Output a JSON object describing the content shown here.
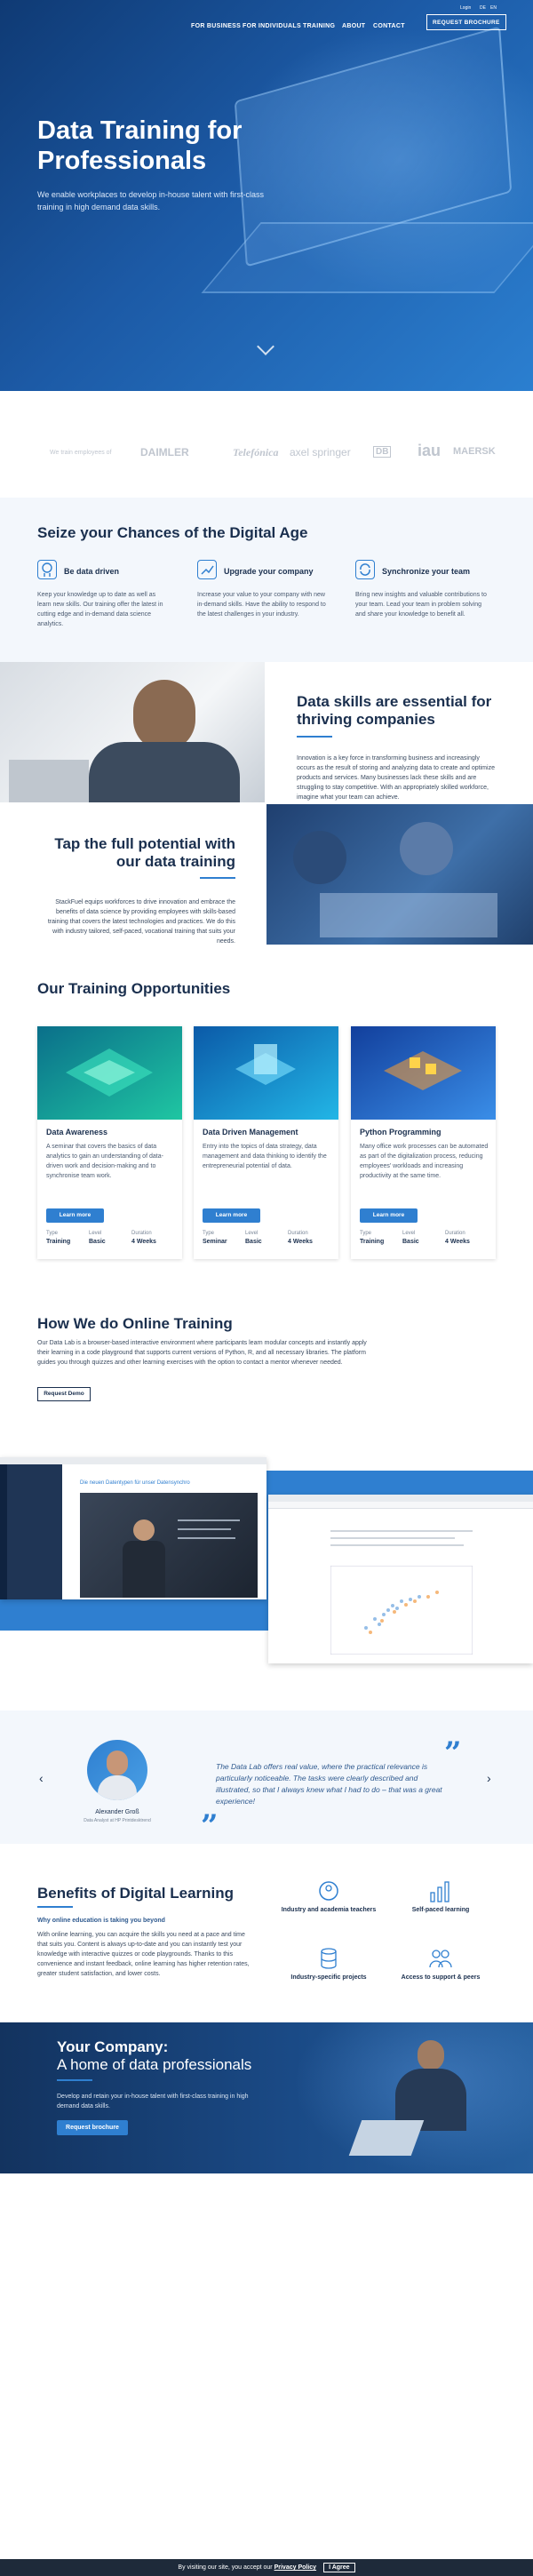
{
  "header": {
    "login": "Login",
    "lang_de": "DE",
    "lang_en": "EN",
    "nav": [
      "FOR BUSINESS",
      "FOR INDIVIDUALS",
      "TRAINING",
      "ABOUT",
      "CONTACT"
    ],
    "cta": "REQUEST BROCHURE"
  },
  "hero": {
    "title": "Data Training for Professionals",
    "subtitle": "We enable workplaces to develop in-house talent with first-class training in high demand data skills."
  },
  "logos": {
    "intro": "We train employees of",
    "items": [
      "DAIMLER",
      "Telefónica",
      "axel springer",
      "DB",
      "iau",
      "MAERSK"
    ]
  },
  "chances": {
    "title": "Seize your Chances of the Digital Age",
    "features": [
      {
        "title": "Be data driven",
        "text": "Keep your knowledge up to date as well as learn new skills. Our training offer the latest in cutting edge and in-demand data science analytics."
      },
      {
        "title": "Upgrade your company",
        "text": "Increase your value to your company with new in-demand skills. Have the ability to respond to the latest challenges in your industry."
      },
      {
        "title": "Synchronize your team",
        "text": "Bring new insights and valuable contributions to your team. Lead your team in problem solving and share your knowledge to benefit all."
      }
    ]
  },
  "skills": {
    "title": "Data skills are essential for thriving companies",
    "text": "Innovation is a key force in transforming business and increasingly occurs as the result of storing and analyzing data to create and optimize products and services. Many businesses lack these skills and are struggling to stay competitive. With an appropriately skilled workforce, imagine what your team can achieve."
  },
  "potential": {
    "title": "Tap the full potential with our data training",
    "text": "StackFuel equips workforces to drive innovation and embrace the benefits of data science by providing employees with skills-based training that covers the latest technologies and practices. We do this with industry tailored, self-paced, vocational training that suits your needs."
  },
  "training": {
    "title": "Our Training Opportunities",
    "learn_more": "Learn more",
    "meta_labels": [
      "Type",
      "Level",
      "Duration"
    ],
    "cards": [
      {
        "title": "Data Awareness",
        "text": "A seminar that covers the basics of data analytics to gain an understanding of data-driven work and decision-making and to synchronise team work.",
        "type": "Training",
        "level": "Basic",
        "duration": "4 Weeks"
      },
      {
        "title": "Data Driven Management",
        "text": "Entry into the topics of data strategy, data management and data thinking to identify the entrepreneurial potential of data.",
        "type": "Seminar",
        "level": "Basic",
        "duration": "4 Weeks"
      },
      {
        "title": "Python Programming",
        "text": "Many office work processes can be automated as part of the digitalization process, reducing employees' workloads and increasing productivity at the same time.",
        "type": "Training",
        "level": "Basic",
        "duration": "4 Weeks"
      }
    ]
  },
  "online": {
    "title": "How We do Online Training",
    "text": "Our Data Lab is a browser-based interactive environment where participants learn modular concepts and instantly apply their learning in a code playground that supports current versions of Python, R, and all necessary libraries. The platform guides you through quizzes and other learning exercises with the option to contact a mentor whenever needed.",
    "button": "Request Demo",
    "video_title": "Die neuen Datentypen für unser Datensynchro"
  },
  "testimonial": {
    "quote": "The Data Lab offers real value, where the practical relevance is particularly noticeable. The tasks were clearly described and illustrated, so that I always knew what I had to do – that was a great experience!",
    "name": "Alexander Groß",
    "role": "Data Analyst at HP Printdesktrend",
    "prev": "‹",
    "next": "›"
  },
  "benefits": {
    "title": "Benefits of Digital Learning",
    "subtitle": "Why online education is taking you beyond",
    "text": "With online learning, you can acquire the skills you need at a pace and time that suits you. Content is always up-to-date and you can instantly test your knowledge with interactive quizzes or code playgrounds. Thanks to this convenience and instant feedback, online learning has higher retention rates, greater student satisfaction, and lower costs.",
    "items": [
      "Industry and academia teachers",
      "Self-paced learning",
      "Industry-specific projects",
      "Access to support & peers"
    ]
  },
  "cta": {
    "title": "Your Company:",
    "subtitle": "A home of data professionals",
    "text": "Develop and retain your in-house talent with first-class training in high demand data skills.",
    "button": "Request brochure"
  },
  "cookie": {
    "text": "By visiting our site, you accept our",
    "link": "Privacy Policy",
    "button": "I Agree"
  },
  "colors": {
    "accent": "#2f7fd0",
    "navy": "#1a2f4e",
    "hero_dark": "#0f3a74"
  }
}
